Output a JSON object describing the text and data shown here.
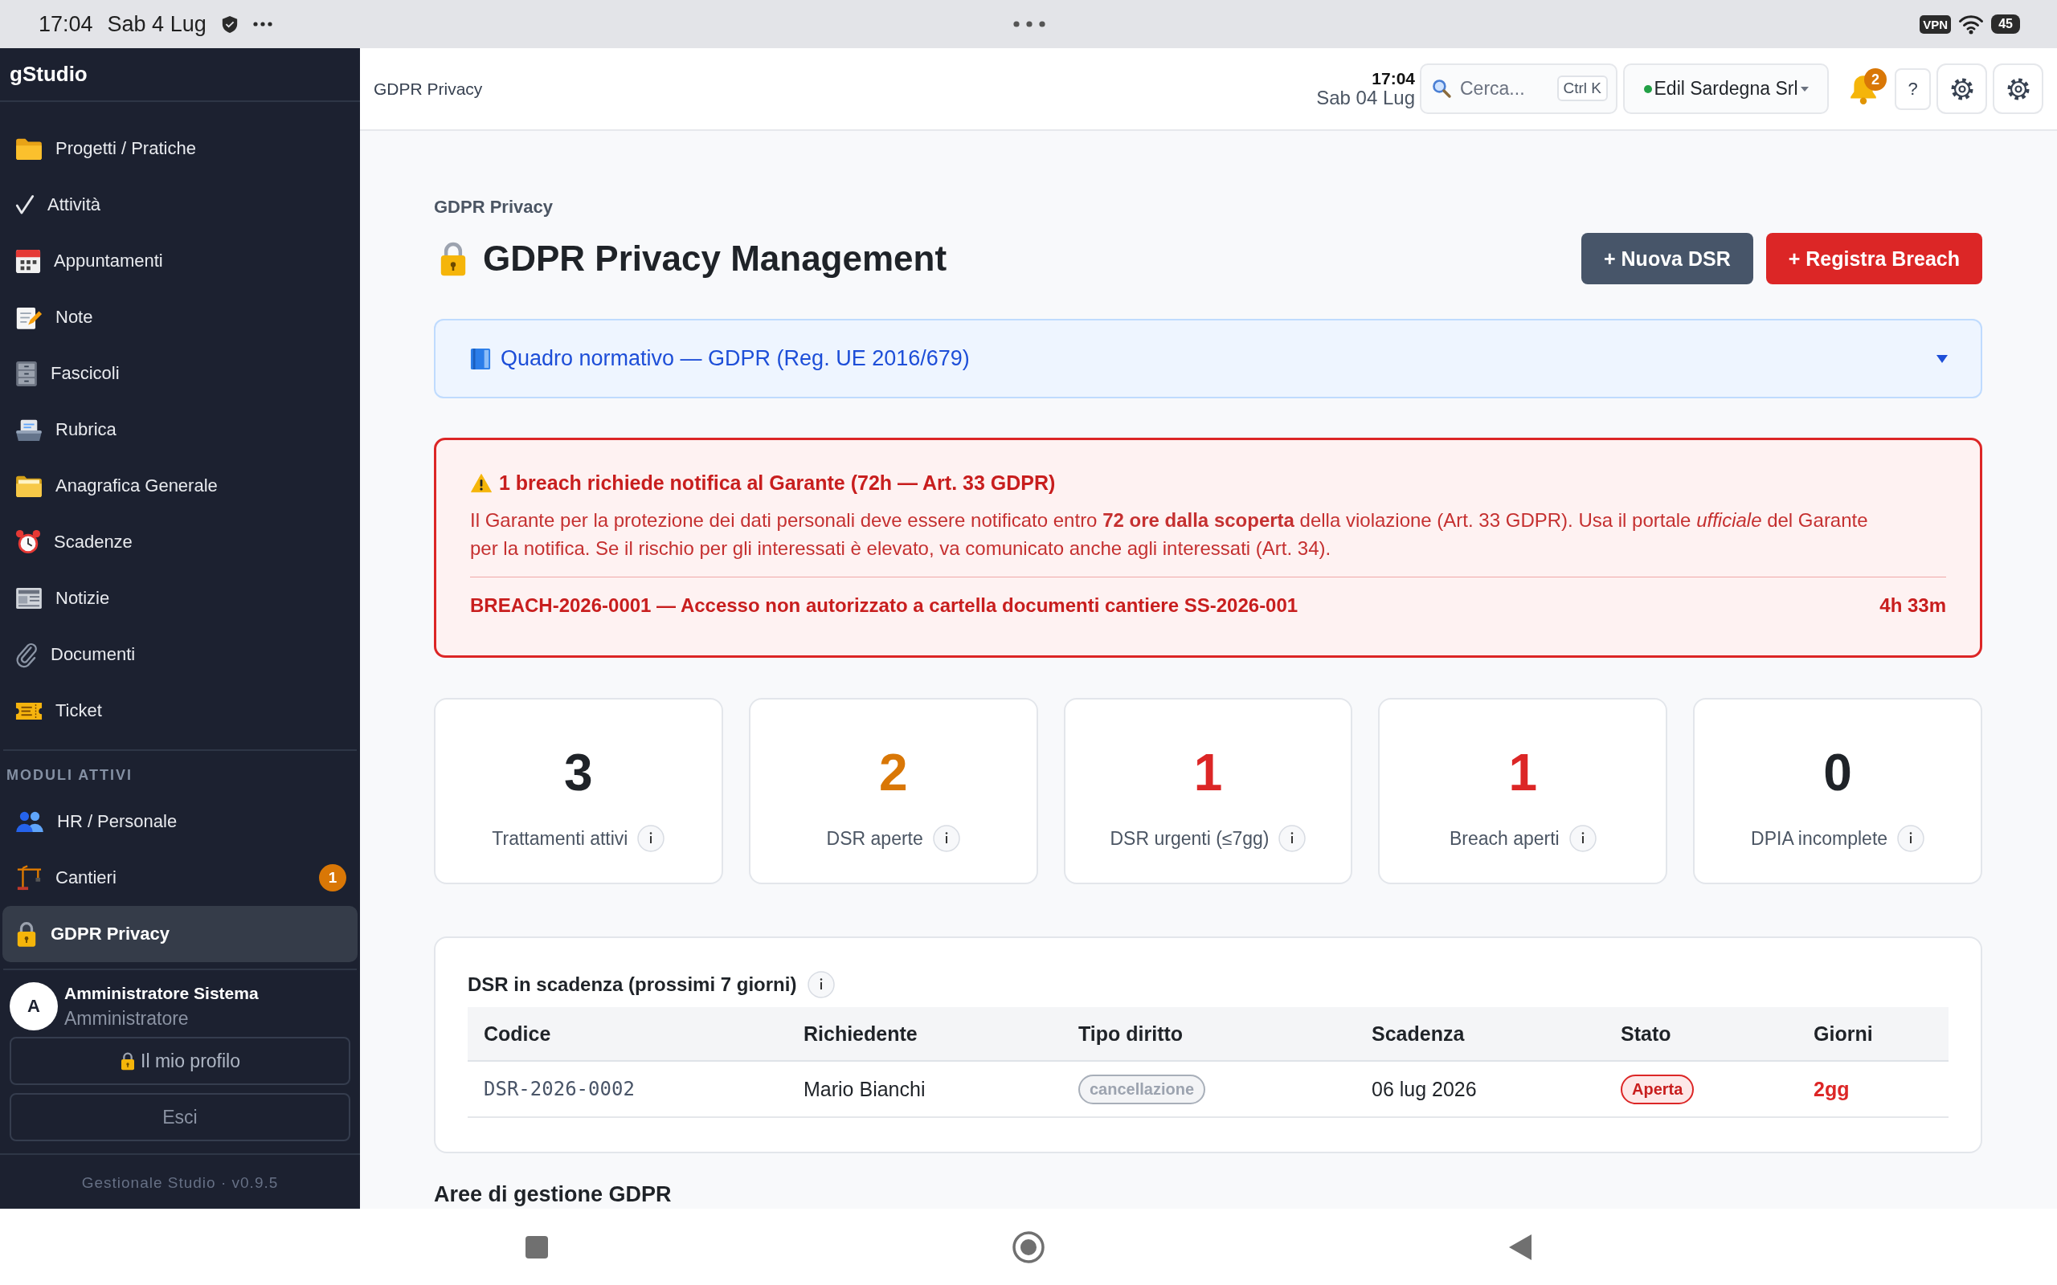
{
  "status_bar": {
    "time": "17:04",
    "date": "Sab 4 Lug",
    "vpn": "VPN",
    "battery": "45"
  },
  "sidebar": {
    "brand": "gStudio",
    "items": [
      {
        "label": "Progetti / Pratiche",
        "selected": false
      },
      {
        "label": "Attività",
        "selected": false
      },
      {
        "label": "Appuntamenti",
        "selected": false
      },
      {
        "label": "Note",
        "selected": false
      },
      {
        "label": "Fascicoli",
        "selected": false
      },
      {
        "label": "Rubrica",
        "selected": false
      },
      {
        "label": "Anagrafica Generale",
        "selected": false
      },
      {
        "label": "Scadenze",
        "selected": false
      },
      {
        "label": "Notizie",
        "selected": false
      },
      {
        "label": "Documenti",
        "selected": false
      },
      {
        "label": "Ticket",
        "selected": false
      }
    ],
    "section_title": "MODULI ATTIVI",
    "modules": [
      {
        "label": "HR / Personale",
        "selected": false
      },
      {
        "label": "Cantieri",
        "badge": "1",
        "selected": false
      },
      {
        "label": "GDPR Privacy",
        "selected": true
      }
    ],
    "user": {
      "initial": "A",
      "name": "Amministratore Sistema",
      "role": "Amministratore"
    },
    "buttons": [
      {
        "label": "Il mio profilo",
        "kind": "profile"
      },
      {
        "label": "Esci",
        "kind": "logout"
      }
    ],
    "footer": "Gestionale Studio · v0.9.5"
  },
  "header": {
    "breadcrumb": "GDPR Privacy",
    "time": "17:04",
    "date": "Sab 04 Lug",
    "search": {
      "placeholder": "Cerca...",
      "shortcut": "Ctrl K"
    },
    "company": "Edil Sardegna Srl",
    "notifications": "2",
    "help": "?"
  },
  "page": {
    "breadcrumb": "GDPR Privacy",
    "title": "GDPR Privacy Management",
    "actions": [
      {
        "label": "+ Nuova DSR",
        "kind": "secondary"
      },
      {
        "label": "+ Registra Breach",
        "kind": "danger"
      }
    ],
    "framework": {
      "title": "Quadro normativo — GDPR (Reg. UE 2016/679)",
      "expanded": false
    },
    "alert": {
      "title": "1 breach richiede notifica al Garante (72h — Art. 33 GDPR)",
      "text": "Il Garante per la protezione dei dati personali deve essere notificato entro **72 ore dalla scoperta** della violazione (Art. 33 GDPR). Usa il portale *ufficiale* del Garante per la notifica. Se il rischio per gli interessati è elevato, va comunicato anche agli interessati (Art. 34).",
      "breaches": [
        {
          "label": "BREACH-2026-0001 — Accesso non autorizzato a cartella documenti cantiere SS-2026-001",
          "time": "4h 33m"
        }
      ]
    },
    "stats": [
      {
        "value": "3",
        "label": "Trattamenti attivi",
        "color": "#1f2328"
      },
      {
        "value": "2",
        "label": "DSR aperte",
        "color": "#d97706"
      },
      {
        "value": "1",
        "label": "DSR urgenti (≤7gg)",
        "color": "#dc2626"
      },
      {
        "value": "1",
        "label": "Breach aperti",
        "color": "#dc2626"
      },
      {
        "value": "0",
        "label": "DPIA incomplete",
        "color": "#1f2328"
      }
    ],
    "deadlines": {
      "title": "DSR in scadenza (prossimi 7 giorni)",
      "columns": [
        "Codice",
        "Richiedente",
        "Tipo diritto",
        "Scadenza",
        "Stato",
        "Giorni"
      ],
      "rows": [
        {
          "cells": [
            {
              "kind": "code",
              "text": "DSR-2026-0002"
            },
            {
              "kind": "text",
              "text": "Mario Bianchi"
            },
            {
              "kind": "tag",
              "text": "cancellazione"
            },
            {
              "kind": "text",
              "text": "06 lug 2026"
            },
            {
              "kind": "status",
              "text": "Aperta"
            },
            {
              "kind": "days",
              "text": "2gg"
            }
          ]
        }
      ]
    },
    "section_title": "Aree di gestione GDPR"
  }
}
